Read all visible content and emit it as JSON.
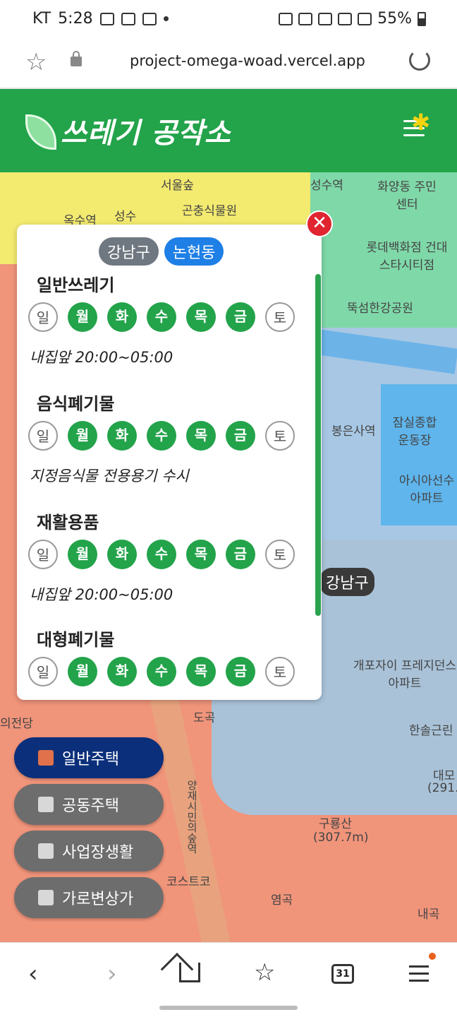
{
  "status_bar": {
    "carrier": "KT",
    "time": "5:28",
    "battery": "55%"
  },
  "browser": {
    "url": "project-omega-woad.vercel.app"
  },
  "header": {
    "title": "쓰레기 공작소"
  },
  "map": {
    "labels": [
      "서울숲",
      "성수역",
      "화양동 주민센터",
      "옥수역",
      "성수",
      "곤충식물원",
      "롯데백화점 건대스타시티점",
      "뚝섬한강공원",
      "봉은사역",
      "잠실종합 운동장",
      "아시아선수 아파트",
      "개포자이 프레지던스아파트",
      "도곡",
      "의전당",
      "구룡산",
      "(307.7m)",
      "염곡",
      "내곡",
      "대모",
      "(291.",
      "한솔근린",
      "코스트코",
      "양재시민의숲역"
    ],
    "district_badge": "강남구"
  },
  "popup": {
    "district": "강남구",
    "dong": "논현동",
    "close_label": "✕",
    "sections": [
      {
        "title": "일반쓰레기",
        "days": [
          {
            "label": "일",
            "active": false
          },
          {
            "label": "월",
            "active": true
          },
          {
            "label": "화",
            "active": true
          },
          {
            "label": "수",
            "active": true
          },
          {
            "label": "목",
            "active": true
          },
          {
            "label": "금",
            "active": true
          },
          {
            "label": "토",
            "active": false
          }
        ],
        "note": "내집앞 20:00~05:00"
      },
      {
        "title": "음식폐기물",
        "days": [
          {
            "label": "일",
            "active": false
          },
          {
            "label": "월",
            "active": true
          },
          {
            "label": "화",
            "active": true
          },
          {
            "label": "수",
            "active": true
          },
          {
            "label": "목",
            "active": true
          },
          {
            "label": "금",
            "active": true
          },
          {
            "label": "토",
            "active": false
          }
        ],
        "note": "지정음식물 전용용기 수시"
      },
      {
        "title": "재활용품",
        "days": [
          {
            "label": "일",
            "active": false
          },
          {
            "label": "월",
            "active": true
          },
          {
            "label": "화",
            "active": true
          },
          {
            "label": "수",
            "active": true
          },
          {
            "label": "목",
            "active": true
          },
          {
            "label": "금",
            "active": true
          },
          {
            "label": "토",
            "active": false
          }
        ],
        "note": "내집앞 20:00~05:00"
      },
      {
        "title": "대형폐기물",
        "days": [
          {
            "label": "일",
            "active": false
          },
          {
            "label": "월",
            "active": true
          },
          {
            "label": "화",
            "active": true
          },
          {
            "label": "수",
            "active": true
          },
          {
            "label": "목",
            "active": true
          },
          {
            "label": "금",
            "active": true
          },
          {
            "label": "토",
            "active": false
          }
        ],
        "note": ""
      }
    ]
  },
  "housing_buttons": [
    {
      "label": "일반주택",
      "active": true
    },
    {
      "label": "공동주택",
      "active": false
    },
    {
      "label": "사업장생활",
      "active": false
    },
    {
      "label": "가로변상가",
      "active": false
    }
  ],
  "bottom_nav": {
    "tabs_count": "31"
  }
}
